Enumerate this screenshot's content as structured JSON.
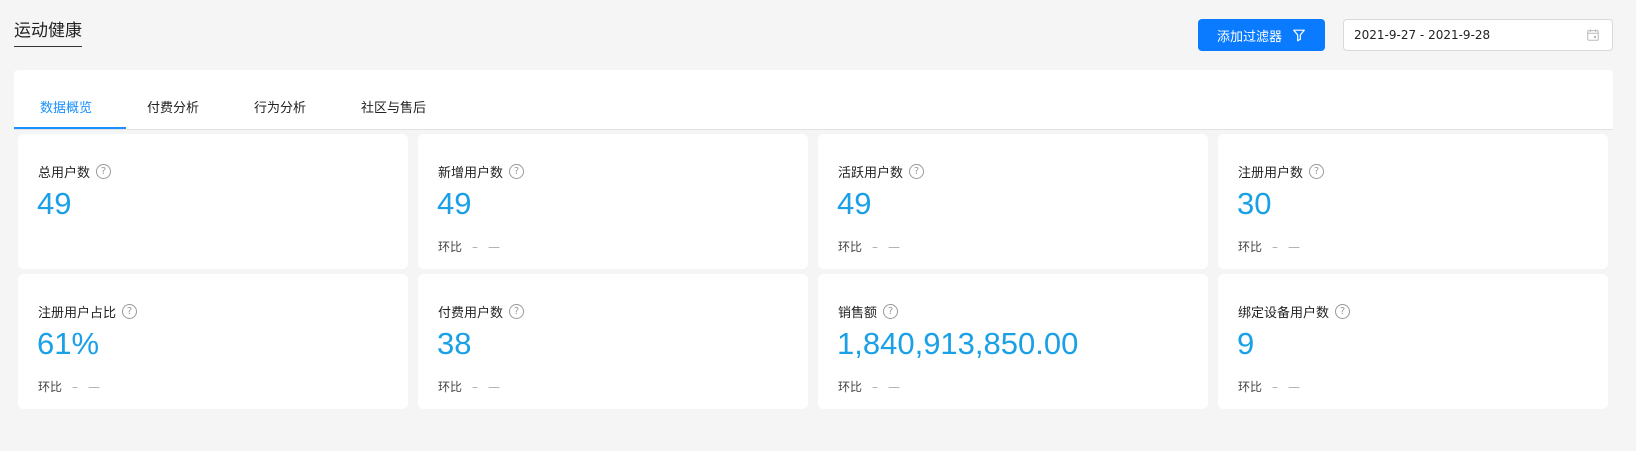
{
  "header": {
    "title": "运动健康",
    "filter_button_label": "添加过滤器",
    "date_range": "2021-9-27 - 2021-9-28"
  },
  "tabs": [
    {
      "label": "数据概览",
      "active": true
    },
    {
      "label": "付费分析",
      "active": false
    },
    {
      "label": "行为分析",
      "active": false
    },
    {
      "label": "社区与售后",
      "active": false
    }
  ],
  "cards": [
    {
      "label": "总用户数",
      "value": "49",
      "compare_label": "",
      "compare_value": "",
      "compare_trend": ""
    },
    {
      "label": "新增用户数",
      "value": "49",
      "compare_label": "环比",
      "compare_value": "–",
      "compare_trend": "—"
    },
    {
      "label": "活跃用户数",
      "value": "49",
      "compare_label": "环比",
      "compare_value": "–",
      "compare_trend": "—"
    },
    {
      "label": "注册用户数",
      "value": "30",
      "compare_label": "环比",
      "compare_value": "–",
      "compare_trend": "—"
    },
    {
      "label": "注册用户占比",
      "value": "61%",
      "compare_label": "环比",
      "compare_value": "–",
      "compare_trend": "—"
    },
    {
      "label": "付费用户数",
      "value": "38",
      "compare_label": "环比",
      "compare_value": "–",
      "compare_trend": "—"
    },
    {
      "label": "销售额",
      "value": "1,840,913,850.00",
      "compare_label": "环比",
      "compare_value": "–",
      "compare_trend": "—"
    },
    {
      "label": "绑定设备用户数",
      "value": "9",
      "compare_label": "环比",
      "compare_value": "–",
      "compare_trend": "—"
    }
  ],
  "icons": {
    "filter": "filter-icon",
    "calendar": "calendar-icon",
    "help": "question-circle-icon"
  },
  "colors": {
    "primary": "#0a7bff",
    "value": "#1aa0e6",
    "tab_active": "#1890ff"
  }
}
